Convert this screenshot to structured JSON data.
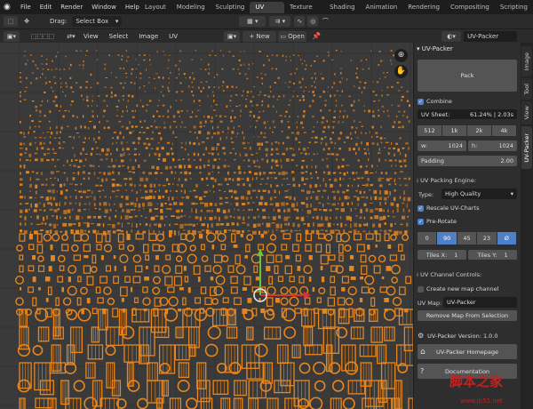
{
  "topbar": {
    "logo": "blender-logo",
    "menus": [
      "File",
      "Edit",
      "Render",
      "Window",
      "Help"
    ],
    "workspaces": [
      "Layout",
      "Modeling",
      "Sculpting",
      "UV Editing",
      "Texture Paint",
      "Shading",
      "Animation",
      "Rendering",
      "Compositing",
      "Scripting"
    ],
    "active_workspace": "UV Editing"
  },
  "toolheader": {
    "drag_label": "Drag:",
    "drag_value": "Select Box"
  },
  "editorheader": {
    "menus": [
      "View",
      "Select",
      "Image",
      "UV"
    ],
    "new_label": "New",
    "open_label": "Open",
    "image_name": "UV-Packer"
  },
  "sidebar": {
    "title": "UV-Packer",
    "pack_label": "Pack",
    "combine_label": "Combine",
    "uv_sheet_label": "UV Sheet:",
    "uv_sheet_value": "61.24% | 2.03s",
    "resolutions": [
      "512",
      "1k",
      "2k",
      "4k"
    ],
    "width_label": "w:",
    "width_value": "1024",
    "height_label": "h:",
    "height_value": "1024",
    "padding_label": "Padding",
    "padding_value": "2.00",
    "engine_label": "UV Packing Engine:",
    "type_label": "Type:",
    "type_value": "High Quality",
    "rescale_label": "Rescale UV-Charts",
    "prerotate_label": "Pre-Rotate",
    "rotations": [
      "0",
      "90",
      "45",
      "23",
      "Ø"
    ],
    "rotation_selected": [
      false,
      true,
      false,
      false,
      true
    ],
    "tiles_x_label": "Tiles X:",
    "tiles_x_value": "1",
    "tiles_y_label": "Tiles Y:",
    "tiles_y_value": "1",
    "channel_label": "UV Channel Controls:",
    "create_map_label": "Create new map channel",
    "uv_map_label": "UV Map:",
    "uv_map_value": "UV-Packer",
    "remove_map_label": "Remove Map From Selection",
    "version_label": "UV-Packer Version: 1.0.0",
    "homepage_label": "UV-Packer Homepage",
    "documentation_label": "Documentation"
  },
  "tabs": [
    "Image",
    "Tool",
    "View",
    "UV-Packer"
  ],
  "active_tab": "UV-Packer",
  "watermark": {
    "text": "脚本之家",
    "url": "www.jb51.net"
  },
  "colors": {
    "accent": "#4f7fc7",
    "island": "#e8861e",
    "background": "#3a3a3a"
  }
}
